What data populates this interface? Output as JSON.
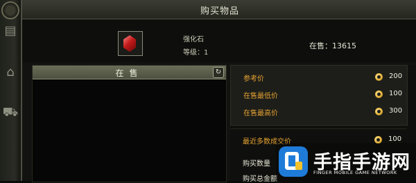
{
  "window": {
    "title": "购买物品"
  },
  "item": {
    "name": "强化石",
    "level": "等级：1",
    "on_sale": "在售：13615"
  },
  "listing": {
    "tab_label": "在售",
    "refresh_icon": "refresh-icon"
  },
  "prices": {
    "reference": {
      "label": "参考价",
      "value": "200"
    },
    "lowest": {
      "label": "在售最低价",
      "value": "100"
    },
    "highest": {
      "label": "在售最高价",
      "value": "300"
    },
    "recent": {
      "label": "最近多数成交价",
      "value": "100"
    },
    "quantity": {
      "label": "购买数量"
    },
    "total": {
      "label": "购买总金额"
    }
  },
  "sidebar": {
    "icons": [
      "shop-icon",
      "bank-icon",
      "cart-icon"
    ]
  },
  "watermark": {
    "brand": "手指手游网",
    "sub": "FINGER MOBILE GAME NETWORK"
  },
  "colors": {
    "label_orange": "#e6a233",
    "coin_gold": "#e7b43b",
    "tab_green": "#5b5e4a"
  }
}
